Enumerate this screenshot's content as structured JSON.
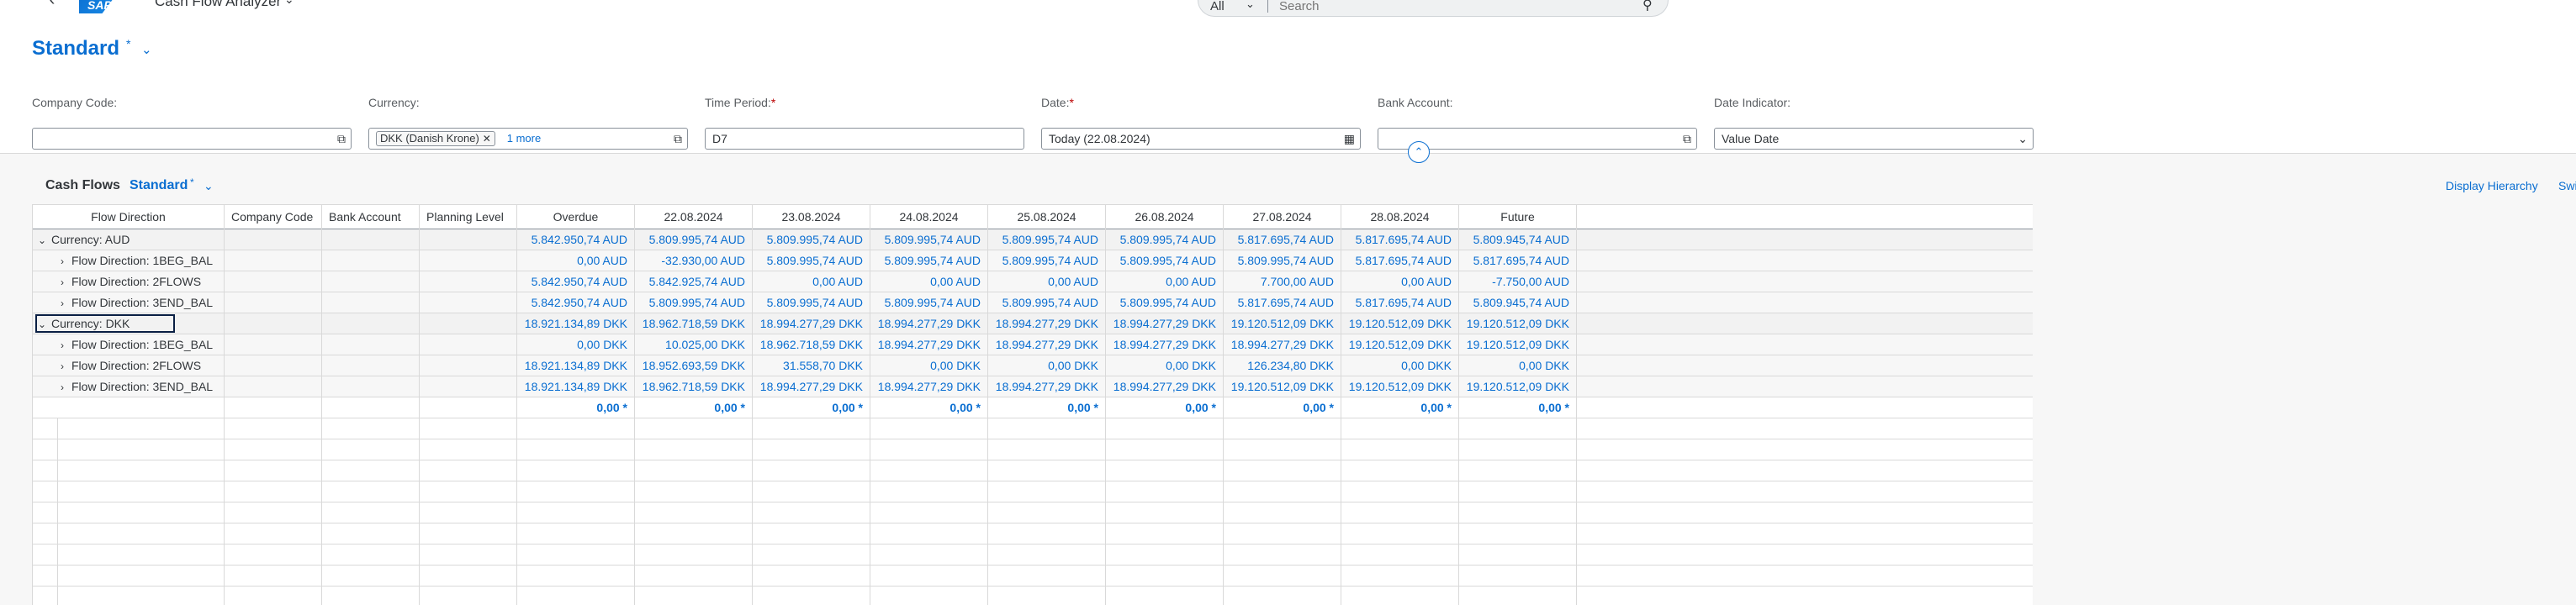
{
  "shell": {
    "app_title": "Cash Flow Analyzer",
    "logo_text": "SAP",
    "search_scope": "All",
    "search_placeholder": "Search"
  },
  "variant": {
    "title": "Standard",
    "modified_marker": "*"
  },
  "filters": [
    {
      "label": "Company Code:",
      "required": false,
      "value": "",
      "icon": "value-help-icon"
    },
    {
      "label": "Currency:",
      "required": false,
      "token": "DKK (Danish Krone)",
      "more": "1 more",
      "icon": "value-help-icon"
    },
    {
      "label": "Time Period:",
      "required": true,
      "value": "D7"
    },
    {
      "label": "Date:",
      "required": true,
      "value": "Today (22.08.2024)",
      "icon": "calendar-icon"
    },
    {
      "label": "Bank Account:",
      "required": false,
      "value": "",
      "icon": "value-help-icon"
    },
    {
      "label": "Date Indicator:",
      "required": false,
      "value": "Value Date",
      "icon": "dropdown-icon"
    }
  ],
  "table": {
    "title": "Cash Flows",
    "variant": "Standard",
    "modified_marker": "*",
    "actions": {
      "display_hierarchy": "Display Hierarchy",
      "switch": "Swi"
    },
    "columns": [
      "Flow Direction",
      "Company Code",
      "Bank Account",
      "Planning Level",
      "Overdue",
      "22.08.2024",
      "23.08.2024",
      "24.08.2024",
      "25.08.2024",
      "26.08.2024",
      "27.08.2024",
      "28.08.2024",
      "Future"
    ],
    "rows": [
      {
        "type": "group",
        "label": "Currency: AUD",
        "values": [
          "5.842.950,74 AUD",
          "5.809.995,74 AUD",
          "5.809.995,74 AUD",
          "5.809.995,74 AUD",
          "5.809.995,74 AUD",
          "5.809.995,74 AUD",
          "5.817.695,74 AUD",
          "5.817.695,74 AUD",
          "5.809.945,74 AUD"
        ]
      },
      {
        "type": "sub",
        "label": "Flow Direction: 1BEG_BAL",
        "values": [
          "0,00 AUD",
          "-32.930,00 AUD",
          "5.809.995,74 AUD",
          "5.809.995,74 AUD",
          "5.809.995,74 AUD",
          "5.809.995,74 AUD",
          "5.809.995,74 AUD",
          "5.817.695,74 AUD",
          "5.817.695,74 AUD"
        ]
      },
      {
        "type": "sub",
        "label": "Flow Direction: 2FLOWS",
        "values": [
          "5.842.950,74 AUD",
          "5.842.925,74 AUD",
          "0,00 AUD",
          "0,00 AUD",
          "0,00 AUD",
          "0,00 AUD",
          "7.700,00 AUD",
          "0,00 AUD",
          "-7.750,00 AUD"
        ]
      },
      {
        "type": "sub",
        "label": "Flow Direction: 3END_BAL",
        "values": [
          "5.842.950,74 AUD",
          "5.809.995,74 AUD",
          "5.809.995,74 AUD",
          "5.809.995,74 AUD",
          "5.809.995,74 AUD",
          "5.809.995,74 AUD",
          "5.817.695,74 AUD",
          "5.817.695,74 AUD",
          "5.809.945,74 AUD"
        ]
      },
      {
        "type": "group",
        "label": "Currency: DKK",
        "focused": true,
        "values": [
          "18.921.134,89 DKK",
          "18.962.718,59 DKK",
          "18.994.277,29 DKK",
          "18.994.277,29 DKK",
          "18.994.277,29 DKK",
          "18.994.277,29 DKK",
          "19.120.512,09 DKK",
          "19.120.512,09 DKK",
          "19.120.512,09 DKK"
        ]
      },
      {
        "type": "sub",
        "label": "Flow Direction: 1BEG_BAL",
        "values": [
          "0,00 DKK",
          "10.025,00 DKK",
          "18.962.718,59 DKK",
          "18.994.277,29 DKK",
          "18.994.277,29 DKK",
          "18.994.277,29 DKK",
          "18.994.277,29 DKK",
          "19.120.512,09 DKK",
          "19.120.512,09 DKK"
        ]
      },
      {
        "type": "sub",
        "label": "Flow Direction: 2FLOWS",
        "values": [
          "18.921.134,89 DKK",
          "18.952.693,59 DKK",
          "31.558,70 DKK",
          "0,00 DKK",
          "0,00 DKK",
          "0,00 DKK",
          "126.234,80 DKK",
          "0,00 DKK",
          "0,00 DKK"
        ]
      },
      {
        "type": "sub",
        "label": "Flow Direction: 3END_BAL",
        "values": [
          "18.921.134,89 DKK",
          "18.962.718,59 DKK",
          "18.994.277,29 DKK",
          "18.994.277,29 DKK",
          "18.994.277,29 DKK",
          "18.994.277,29 DKK",
          "19.120.512,09 DKK",
          "19.120.512,09 DKK",
          "19.120.512,09 DKK"
        ]
      },
      {
        "type": "total",
        "label": "",
        "values": [
          "0,00 *",
          "0,00 *",
          "0,00 *",
          "0,00 *",
          "0,00 *",
          "0,00 *",
          "0,00 *",
          "0,00 *",
          "0,00 *"
        ]
      }
    ],
    "empty_rows": 9
  },
  "colors": {
    "accent": "#0a6ed1",
    "text": "#32363a",
    "border": "#d9d9d9"
  }
}
